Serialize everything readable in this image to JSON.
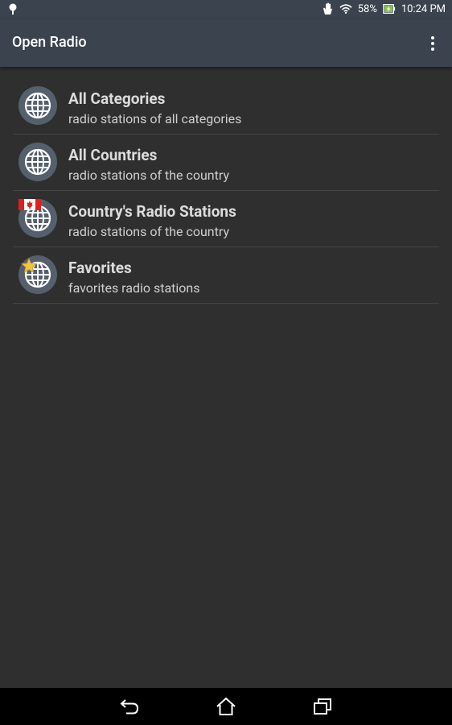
{
  "status_bar": {
    "battery": "58%",
    "time": "10:24 PM",
    "icons": [
      "android-debug-icon",
      "touch-hand-icon",
      "wifi-icon",
      "battery-charging-icon"
    ]
  },
  "app_bar": {
    "title": "Open Radio",
    "overflow_icon": "more-vert-icon"
  },
  "list": {
    "items": [
      {
        "title": "All Categories",
        "subtitle": "radio stations of all categories",
        "icon": "globe-icon"
      },
      {
        "title": "All Countries",
        "subtitle": "radio stations of the country",
        "icon": "globe-icon"
      },
      {
        "title": "Country's Radio Stations",
        "subtitle": "radio stations of the country",
        "icon": "globe-flag-icon"
      },
      {
        "title": "Favorites",
        "subtitle": "favorites radio stations",
        "icon": "globe-star-icon"
      }
    ]
  },
  "nav_bar": {
    "buttons": [
      "back-icon",
      "home-icon",
      "recents-icon"
    ]
  },
  "colors": {
    "app_bar": "#3a434e",
    "background": "#2f2f2f",
    "icon_circle": "#55606c",
    "divider": "#444444",
    "battery_accent": "#8bc34a"
  }
}
